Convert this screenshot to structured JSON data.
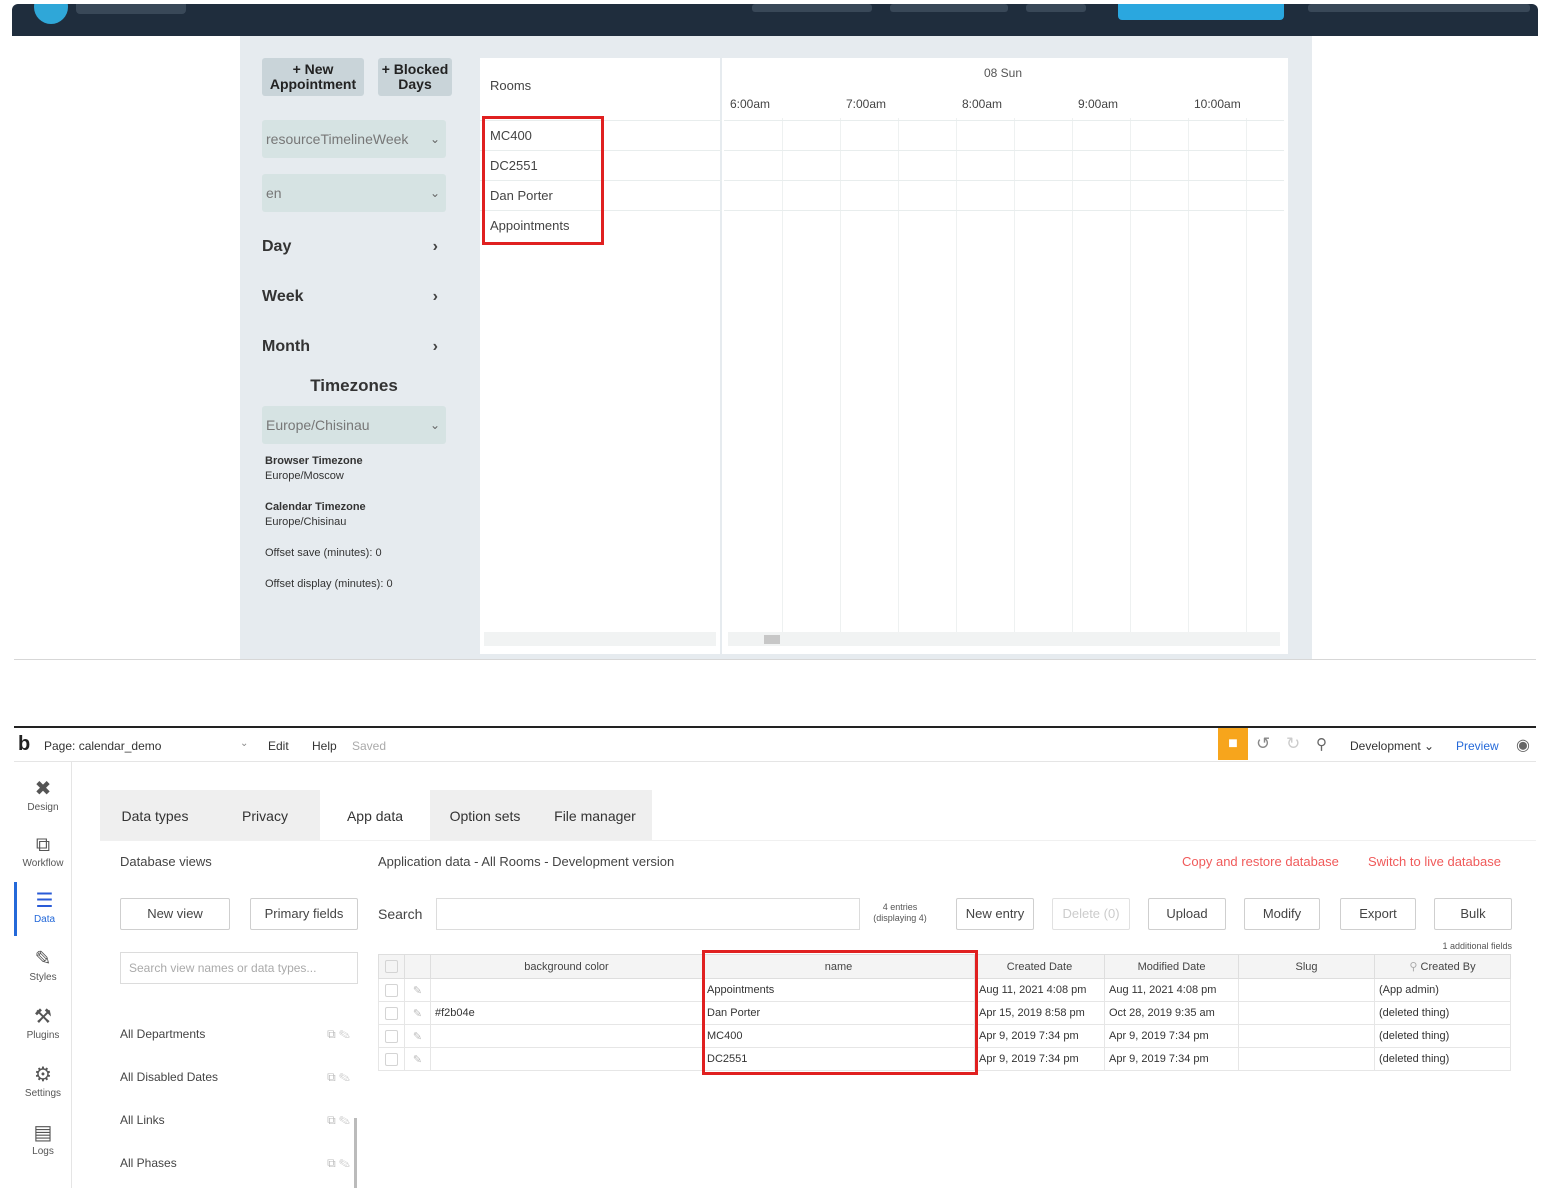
{
  "calendar": {
    "buttons": {
      "new_appointment": "+ New Appointment",
      "blocked_days": "+ Blocked Days"
    },
    "view_select": "resourceTimelineWeek",
    "language_select": "en",
    "nav": {
      "day": "Day",
      "week": "Week",
      "month": "Month"
    },
    "timezones_heading": "Timezones",
    "timezone_select": "Europe/Chisinau",
    "browser_timezone_label": "Browser Timezone",
    "browser_timezone_value": "Europe/Moscow",
    "calendar_timezone_label": "Calendar Timezone",
    "calendar_timezone_value": "Europe/Chisinau",
    "offset_save": "Offset save (minutes): 0",
    "offset_display": "Offset display (minutes): 0",
    "grid": {
      "rooms_header": "Rooms",
      "date_header": "08 Sun",
      "times": [
        "6:00am",
        "7:00am",
        "8:00am",
        "9:00am",
        "10:00am"
      ],
      "resources": [
        "MC400",
        "DC2551",
        "Dan Porter",
        "Appointments"
      ]
    }
  },
  "editor": {
    "page_selector": "Page: calendar_demo",
    "menu": {
      "edit": "Edit",
      "help": "Help",
      "saved": "Saved"
    },
    "environment": "Development",
    "preview": "Preview",
    "rail": [
      {
        "label": "Design",
        "icon": "design-icon",
        "glyph": "✖"
      },
      {
        "label": "Workflow",
        "icon": "workflow-icon",
        "glyph": "⧉"
      },
      {
        "label": "Data",
        "icon": "database-icon",
        "glyph": "☰"
      },
      {
        "label": "Styles",
        "icon": "brush-icon",
        "glyph": "✎"
      },
      {
        "label": "Plugins",
        "icon": "plugin-icon",
        "glyph": "⚒"
      },
      {
        "label": "Settings",
        "icon": "gear-icon",
        "glyph": "⚙"
      },
      {
        "label": "Logs",
        "icon": "document-icon",
        "glyph": "▤"
      }
    ],
    "tabs": [
      "Data types",
      "Privacy",
      "App data",
      "Option sets",
      "File manager"
    ],
    "database_views_label": "Database views",
    "new_view": "New view",
    "primary_fields": "Primary fields",
    "search_views_placeholder": "Search view names or data types...",
    "views": [
      "All Departments",
      "All Disabled Dates",
      "All Links",
      "All Phases"
    ],
    "app_data_title": "Application data - All Rooms - Development version",
    "copy_restore": "Copy and restore database",
    "switch_live": "Switch to live database",
    "search_label": "Search",
    "entries_count": "4 entries",
    "entries_displaying": "(displaying 4)",
    "actions": {
      "new_entry": "New entry",
      "delete": "Delete (0)",
      "upload": "Upload",
      "modify": "Modify",
      "export": "Export",
      "bulk": "Bulk"
    },
    "additional_fields": "1 additional fields",
    "table": {
      "columns": [
        "background color",
        "name",
        "Created Date",
        "Modified Date",
        "Slug",
        "Created By"
      ],
      "rows": [
        [
          "",
          "Appointments",
          "Aug 11, 2021 4:08 pm",
          "Aug 11, 2021 4:08 pm",
          "",
          "(App admin)"
        ],
        [
          "#f2b04e",
          "Dan Porter",
          "Apr 15, 2019 8:58 pm",
          "Oct 28, 2019 9:35 am",
          "",
          "(deleted thing)"
        ],
        [
          "",
          "MC400",
          "Apr 9, 2019 7:34 pm",
          "Apr 9, 2019 7:34 pm",
          "",
          "(deleted thing)"
        ],
        [
          "",
          "DC2551",
          "Apr 9, 2019 7:34 pm",
          "Apr 9, 2019 7:34 pm",
          "",
          "(deleted thing)"
        ]
      ]
    }
  }
}
